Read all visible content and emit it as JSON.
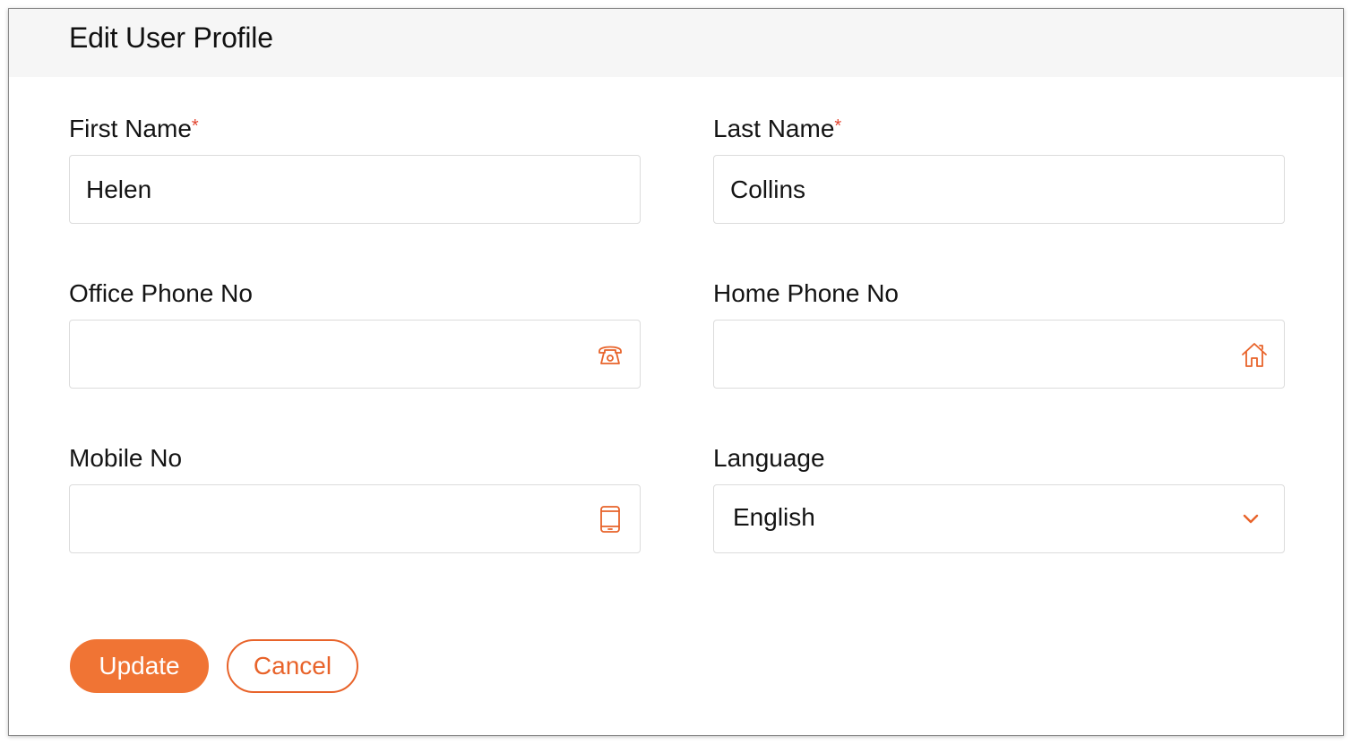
{
  "dialog": {
    "title": "Edit User Profile"
  },
  "fields": {
    "first_name": {
      "label": "First Name",
      "required_mark": "*",
      "value": "Helen"
    },
    "last_name": {
      "label": "Last Name",
      "required_mark": "*",
      "value": "Collins"
    },
    "office_phone": {
      "label": "Office Phone No",
      "value": "",
      "icon": "telephone-icon"
    },
    "home_phone": {
      "label": "Home Phone No",
      "value": "",
      "icon": "home-icon"
    },
    "mobile": {
      "label": "Mobile No",
      "value": "",
      "icon": "mobile-phone-icon"
    },
    "language": {
      "label": "Language",
      "selected": "English",
      "icon": "chevron-down-icon"
    }
  },
  "actions": {
    "update_label": "Update",
    "cancel_label": "Cancel"
  },
  "colors": {
    "accent": "#f07434",
    "required": "#e2442f",
    "header_bg": "#f6f6f6",
    "border": "#dcdcdc"
  }
}
